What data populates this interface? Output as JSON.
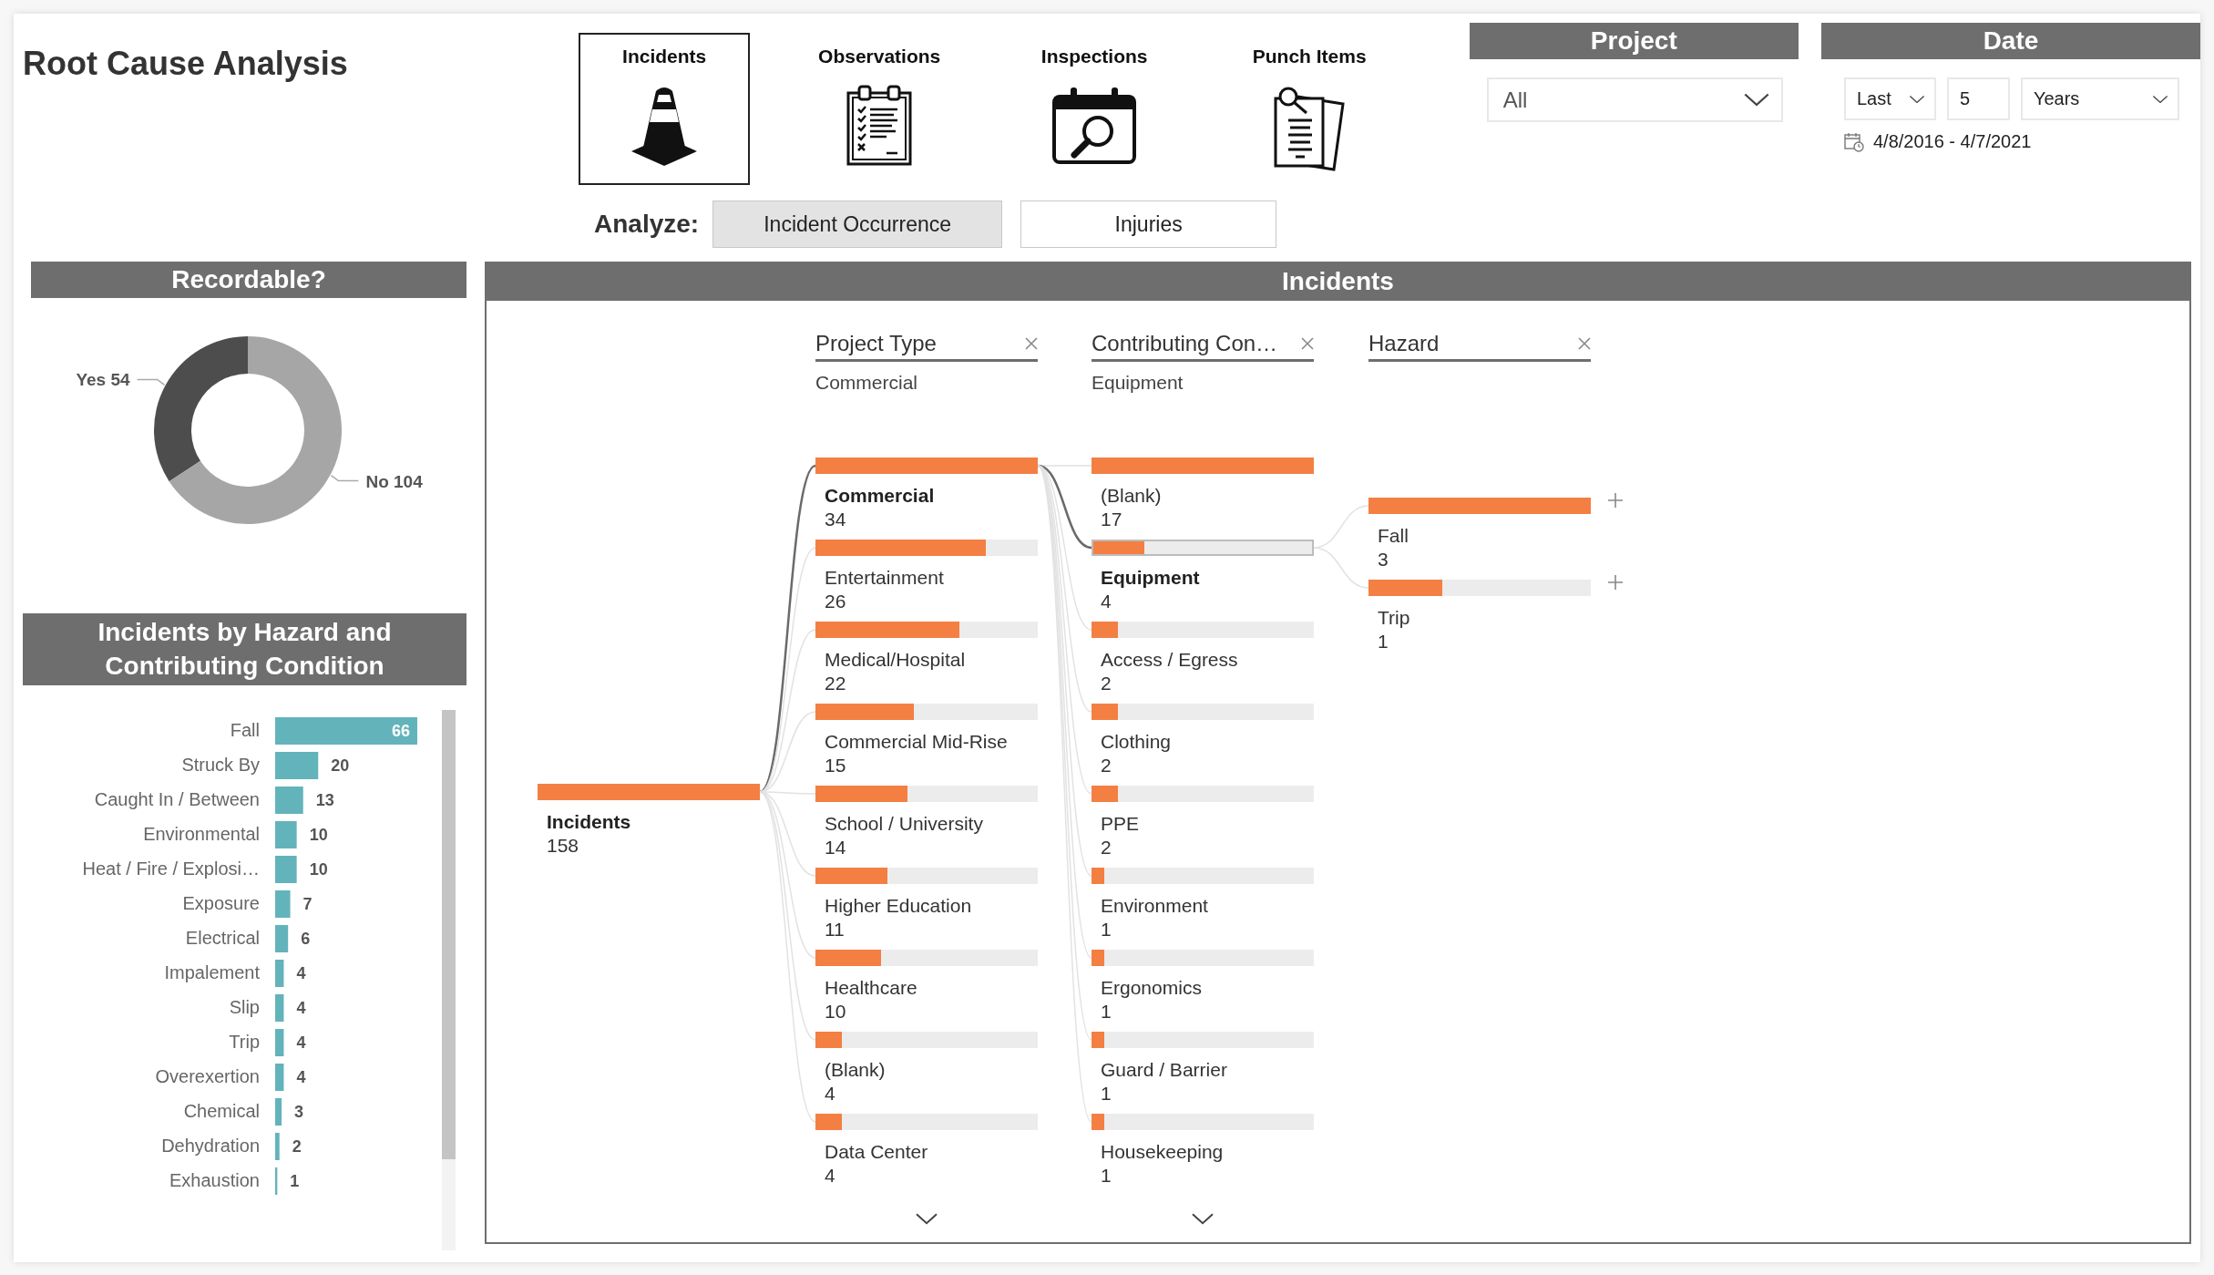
{
  "title": "Root Cause Analysis",
  "tabs": [
    {
      "label": "Incidents",
      "selected": true
    },
    {
      "label": "Observations",
      "selected": false
    },
    {
      "label": "Inspections",
      "selected": false
    },
    {
      "label": "Punch Items",
      "selected": false
    }
  ],
  "analyze": {
    "label": "Analyze:",
    "options": [
      {
        "label": "Incident Occurrence",
        "selected": true
      },
      {
        "label": "Injuries",
        "selected": false
      }
    ]
  },
  "project": {
    "title": "Project",
    "value": "All"
  },
  "date": {
    "title": "Date",
    "mode": "Last",
    "count": "5",
    "unit": "Years",
    "range": "4/8/2016 - 4/7/2021"
  },
  "recordable": {
    "title": "Recordable?",
    "chart_data": {
      "type": "donut",
      "categories": [
        "Yes",
        "No"
      ],
      "values": [
        54,
        104
      ],
      "data_labels": true
    }
  },
  "hazard_chart": {
    "title": "Incidents by Hazard and Contributing Condition",
    "chart_data": {
      "type": "bar",
      "orientation": "horizontal",
      "categories": [
        "Fall",
        "Struck By",
        "Caught In / Between",
        "Environmental",
        "Heat / Fire / Explosi…",
        "Exposure",
        "Electrical",
        "Impalement",
        "Slip",
        "Trip",
        "Overexertion",
        "Chemical",
        "Dehydration",
        "Exhaustion"
      ],
      "values": [
        66,
        20,
        13,
        10,
        10,
        7,
        6,
        4,
        4,
        4,
        4,
        3,
        2,
        1
      ],
      "data_labels": true
    }
  },
  "incidents": {
    "title": "Incidents",
    "root": {
      "label": "Incidents",
      "value": "158",
      "level": 1
    },
    "levels": [
      {
        "header": "Project Type",
        "filter": "Commercial",
        "more_below": true,
        "nodes": [
          {
            "label": "Commercial",
            "value": "34",
            "level": 1,
            "selected": true,
            "expandable": false
          },
          {
            "label": "Entertainment",
            "value": "26",
            "level": 0.765,
            "selected": false,
            "expandable": false
          },
          {
            "label": "Medical/Hospital",
            "value": "22",
            "level": 0.647,
            "selected": false,
            "expandable": false
          },
          {
            "label": "Commercial Mid-Rise",
            "value": "15",
            "level": 0.441,
            "selected": false,
            "expandable": false
          },
          {
            "label": "School / University",
            "value": "14",
            "level": 0.412,
            "selected": false,
            "expandable": false
          },
          {
            "label": "Higher Education",
            "value": "11",
            "level": 0.324,
            "selected": false,
            "expandable": false
          },
          {
            "label": "Healthcare",
            "value": "10",
            "level": 0.294,
            "selected": false,
            "expandable": false
          },
          {
            "label": "(Blank)",
            "value": "4",
            "level": 0.118,
            "selected": false,
            "expandable": false
          },
          {
            "label": "Data Center",
            "value": "4",
            "level": 0.118,
            "selected": false,
            "expandable": false
          }
        ]
      },
      {
        "header": "Contributing Con…",
        "filter": "Equipment",
        "more_below": true,
        "nodes": [
          {
            "label": "(Blank)",
            "value": "17",
            "level": 1,
            "selected": false,
            "expandable": false
          },
          {
            "label": "Equipment",
            "value": "4",
            "level": 0.235,
            "selected": true,
            "expandable": false
          },
          {
            "label": "Access / Egress",
            "value": "2",
            "level": 0.118,
            "selected": false,
            "expandable": false
          },
          {
            "label": "Clothing",
            "value": "2",
            "level": 0.118,
            "selected": false,
            "expandable": false
          },
          {
            "label": "PPE",
            "value": "2",
            "level": 0.118,
            "selected": false,
            "expandable": false
          },
          {
            "label": "Environment",
            "value": "1",
            "level": 0.059,
            "selected": false,
            "expandable": false
          },
          {
            "label": "Ergonomics",
            "value": "1",
            "level": 0.059,
            "selected": false,
            "expandable": false
          },
          {
            "label": "Guard / Barrier",
            "value": "1",
            "level": 0.059,
            "selected": false,
            "expandable": false
          },
          {
            "label": "Housekeeping",
            "value": "1",
            "level": 0.059,
            "selected": false,
            "expandable": false
          }
        ]
      },
      {
        "header": "Hazard",
        "more_below": false,
        "nodes": [
          {
            "label": "Fall",
            "value": "3",
            "level": 1,
            "selected": false,
            "expandable": true
          },
          {
            "label": "Trip",
            "value": "1",
            "level": 0.333,
            "selected": false,
            "expandable": true
          }
        ]
      }
    ]
  }
}
